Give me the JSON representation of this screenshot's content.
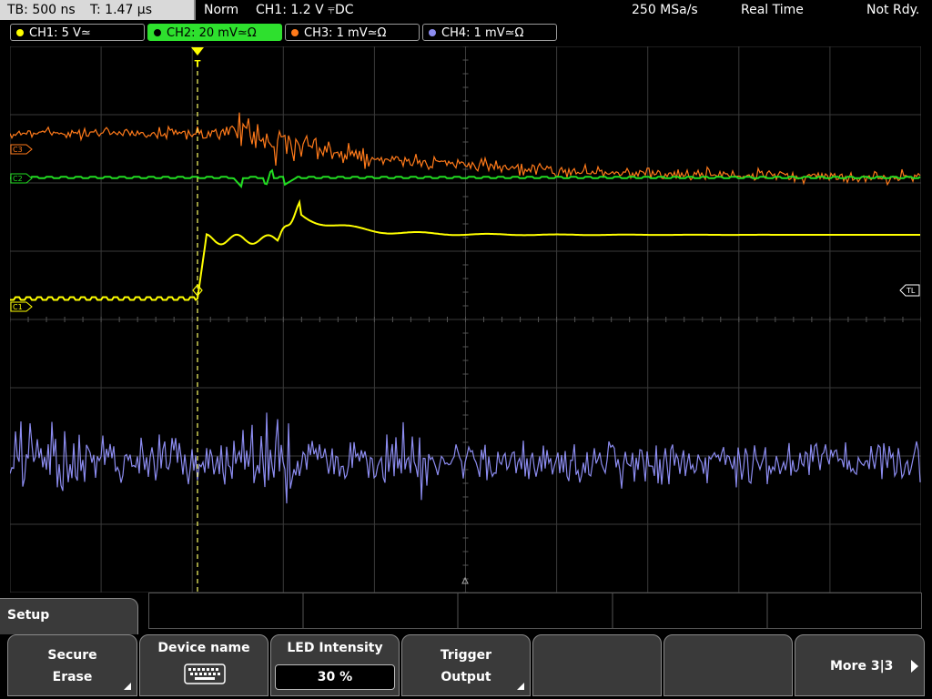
{
  "header": {
    "timebase": "TB: 500 ns",
    "trigger_time": "T: 1.47 µs",
    "mode": "Norm",
    "trigger_info": "CH1: 1.2 V ⫧DC",
    "sample_rate": "250 MSa/s",
    "acq_mode": "Real Time",
    "status": "Not Rdy."
  },
  "channels": [
    {
      "label": "CH1: 5 V≃",
      "color": "#ffff00",
      "active": false
    },
    {
      "label": "CH2: 20 mV≃Ω",
      "color": "#22dd22",
      "active": true
    },
    {
      "label": "CH3: 1 mV≃Ω",
      "color": "#ff7a1a",
      "active": false
    },
    {
      "label": "CH4: 1 mV≃Ω",
      "color": "#8c8cf0",
      "active": false
    }
  ],
  "screen": {
    "markers": {
      "c3": "C3",
      "c2": "C2",
      "c1": "C1",
      "tl": "TL"
    },
    "trigger_marker": "T",
    "colors": {
      "ch1": "#ffff00",
      "ch2": "#22dd22",
      "ch3": "#ff7a1a",
      "ch4": "#8c8cf0",
      "grid": "#3a3a3a"
    }
  },
  "menu": {
    "title": "Setup",
    "buttons": [
      {
        "line1": "Secure",
        "line2": "Erase"
      },
      {
        "line1": "Device name"
      },
      {
        "line1": "LED Intensity",
        "value": "30 %"
      },
      {
        "line1": "Trigger",
        "line2": "Output"
      },
      {
        "line1": ""
      },
      {
        "line1": ""
      },
      {
        "line1": "More 3|3"
      }
    ]
  }
}
